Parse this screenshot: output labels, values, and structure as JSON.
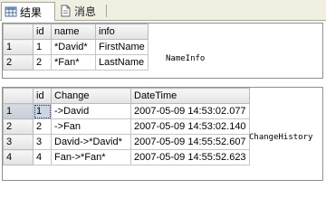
{
  "tabs": {
    "results": {
      "label": "结果",
      "icon": "grid-icon"
    },
    "messages": {
      "label": "消息",
      "icon": "message-document-icon"
    }
  },
  "result_sets": [
    {
      "name_label": "NameInfo",
      "columns": [
        "",
        "id",
        "name",
        "info"
      ],
      "rows": [
        [
          "1",
          "1",
          "*David*",
          "FirstName"
        ],
        [
          "2",
          "2",
          "*Fan*",
          "LastName"
        ]
      ]
    },
    {
      "name_label": "ChangeHistory",
      "columns": [
        "",
        "id",
        "Change",
        "DateTime"
      ],
      "rows": [
        [
          "1",
          "1",
          "->David",
          "2007-05-09 14:53:02.077"
        ],
        [
          "2",
          "2",
          "->Fan",
          "2007-05-09 14:53:02.140"
        ],
        [
          "3",
          "3",
          "David->*David*",
          "2007-05-09 14:55:52.607"
        ],
        [
          "4",
          "4",
          "Fan->*Fan*",
          "2007-05-09 14:55:52.623"
        ]
      ]
    }
  ],
  "colors": {
    "tabstrip_bg": "#f1efe2",
    "selected_cell": "#c9d6e6",
    "grid_line": "#c5c5c5"
  }
}
